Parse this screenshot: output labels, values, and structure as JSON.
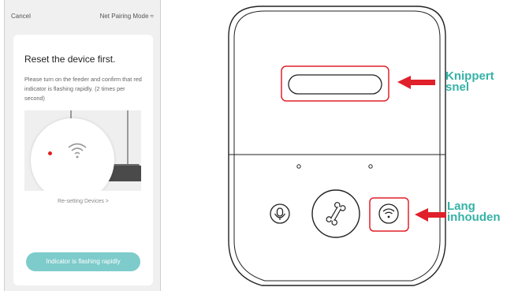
{
  "phone": {
    "cancel": "Cancel",
    "mode": "Net Pairing Mode ≈",
    "title": "Reset the device first.",
    "description": "Please turn on the feeder and confirm that red indicator is flashing rapidly. (2 times per second)",
    "reset_link": "Re-setting Devices >",
    "button": "Indicator is flashing rapidly"
  },
  "annotations": {
    "flash_fast": "Knippert snel",
    "hold_long": "Lang inhouden"
  },
  "colors": {
    "accent": "#35b2a7",
    "button": "#7ecbcb",
    "highlight": "#e0202a",
    "indicator": "#e02020"
  },
  "icons": {
    "wifi": "wifi-icon",
    "mic": "microphone-icon",
    "bone": "bone-icon",
    "arrow": "arrow-left-icon"
  }
}
